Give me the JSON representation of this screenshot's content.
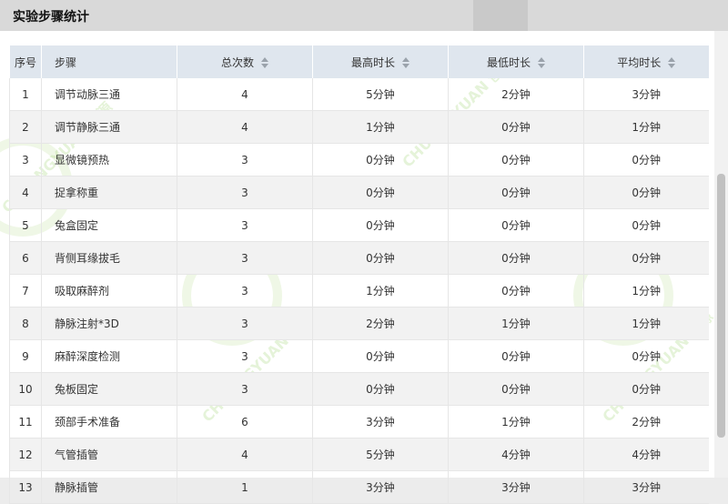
{
  "window": {
    "title": "实验步骤统计"
  },
  "table": {
    "headers": [
      "序号",
      "步骤",
      "总次数",
      "最高时长",
      "最低时长",
      "平均时长"
    ],
    "rows": [
      [
        "1",
        "调节动脉三通",
        "4",
        "5分钟",
        "2分钟",
        "3分钟"
      ],
      [
        "2",
        "调节静脉三通",
        "4",
        "1分钟",
        "0分钟",
        "1分钟"
      ],
      [
        "3",
        "显微镜预热",
        "3",
        "0分钟",
        "0分钟",
        "0分钟"
      ],
      [
        "4",
        "捉拿称重",
        "3",
        "0分钟",
        "0分钟",
        "0分钟"
      ],
      [
        "5",
        "兔盒固定",
        "3",
        "0分钟",
        "0分钟",
        "0分钟"
      ],
      [
        "6",
        "背侧耳缘拔毛",
        "3",
        "0分钟",
        "0分钟",
        "0分钟"
      ],
      [
        "7",
        "吸取麻醉剂",
        "3",
        "1分钟",
        "0分钟",
        "1分钟"
      ],
      [
        "8",
        "静脉注射*3D",
        "3",
        "2分钟",
        "1分钟",
        "1分钟"
      ],
      [
        "9",
        "麻醉深度检测",
        "3",
        "0分钟",
        "0分钟",
        "0分钟"
      ],
      [
        "10",
        "兔板固定",
        "3",
        "0分钟",
        "0分钟",
        "0分钟"
      ],
      [
        "11",
        "颈部手术准备",
        "6",
        "3分钟",
        "1分钟",
        "2分钟"
      ],
      [
        "12",
        "气管插管",
        "4",
        "5分钟",
        "4分钟",
        "4分钟"
      ],
      [
        "13",
        "静脉插管",
        "1",
        "3分钟",
        "3分钟",
        "3分钟"
      ]
    ]
  },
  "watermark": {
    "brand": "CHUANGYUAN 创源"
  },
  "icons": {
    "sort": "sort-icon"
  }
}
